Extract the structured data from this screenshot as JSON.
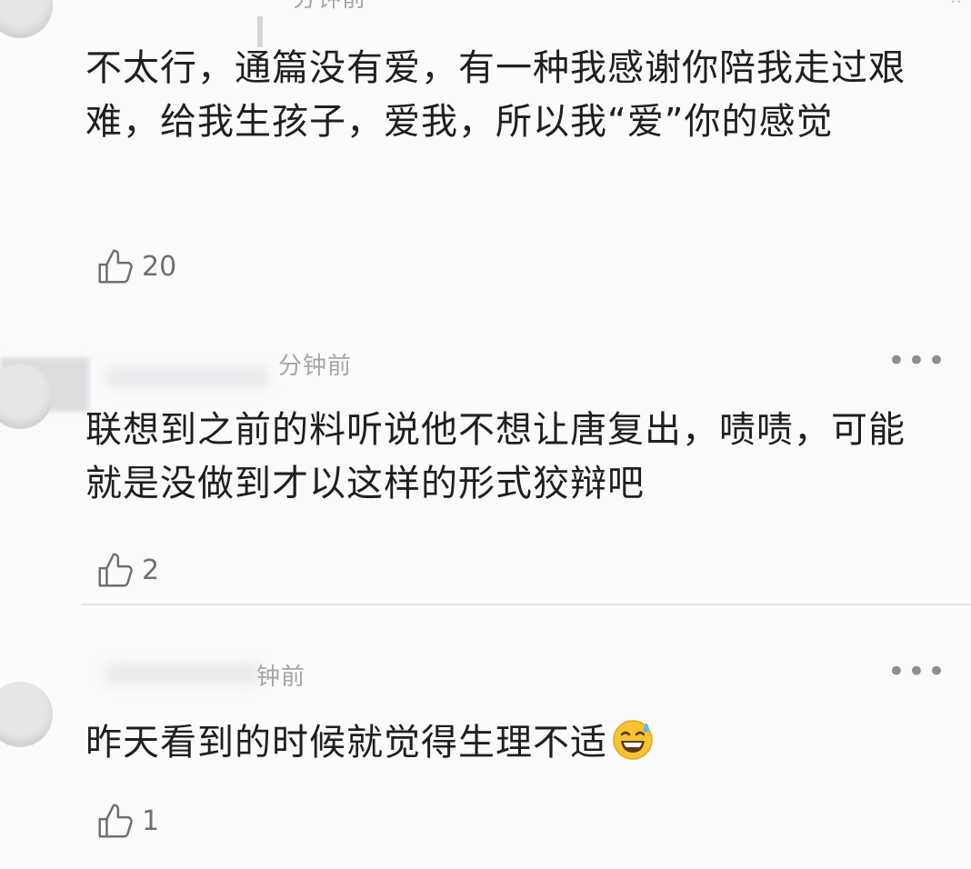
{
  "comments": [
    {
      "time": "分钟前",
      "text": "不太行，通篇没有爱，有一种我感谢你陪我走过艰难，给我生孩子，爱我，所以我“爱”你的感觉",
      "likes": "20",
      "like_icon": "thumbs-up-icon"
    },
    {
      "time": "分钟前",
      "text": "联想到之前的料听说他不想让唐复出，啧啧，可能就是没做到才以这样的形式狡辩吧",
      "likes": "2",
      "like_icon": "thumbs-up-icon",
      "more_label": "•••"
    },
    {
      "time": "钟前",
      "text": "昨天看到的时候就觉得生理不适",
      "emoji": "grinning-sweat-emoji",
      "likes": "1",
      "like_icon": "thumbs-up-icon",
      "more_label": "•••"
    }
  ],
  "colors": {
    "background": "#fbfbfc",
    "text": "#1f1f22",
    "meta": "#a5a5aa",
    "icon": "#6f6f74"
  }
}
